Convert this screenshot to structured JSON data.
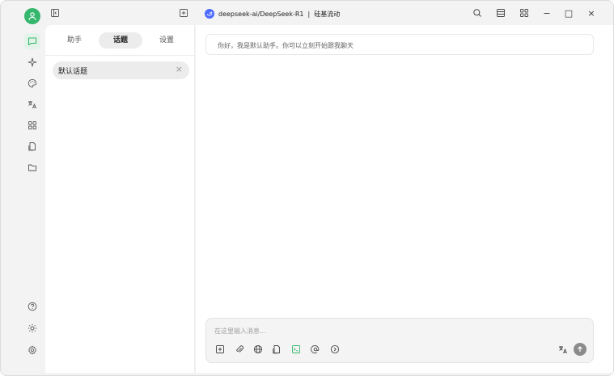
{
  "titlebar": {
    "model_name": "deepseek-ai/DeepSeek-R1",
    "provider": "硅基流动",
    "separator": " | "
  },
  "sidebar": {
    "tabs": [
      {
        "label": "助手",
        "active": false
      },
      {
        "label": "话题",
        "active": true
      },
      {
        "label": "设置",
        "active": false
      }
    ],
    "topics": [
      {
        "label": "默认话题",
        "close_glyph": "×"
      }
    ]
  },
  "chat": {
    "greeting": "你好，我是默认助手。你可以立刻开始跟我聊天",
    "input_placeholder": "在这里输入消息..."
  },
  "window": {
    "minimize_glyph": "−",
    "maximize_glyph": "□",
    "close_glyph": "×"
  },
  "colors": {
    "accent": "#35b66d",
    "model_badge": "#4d6bfe",
    "send_button": "#8b8b8b"
  },
  "icons": {
    "rail": [
      "user-avatar",
      "chat-bubble",
      "sparkle",
      "palette",
      "translate",
      "apps-grid",
      "files",
      "folder",
      "help",
      "brightness",
      "settings"
    ],
    "toolbar": [
      "new-topic",
      "attach",
      "web-search",
      "files",
      "terminal",
      "mention",
      "more"
    ]
  }
}
